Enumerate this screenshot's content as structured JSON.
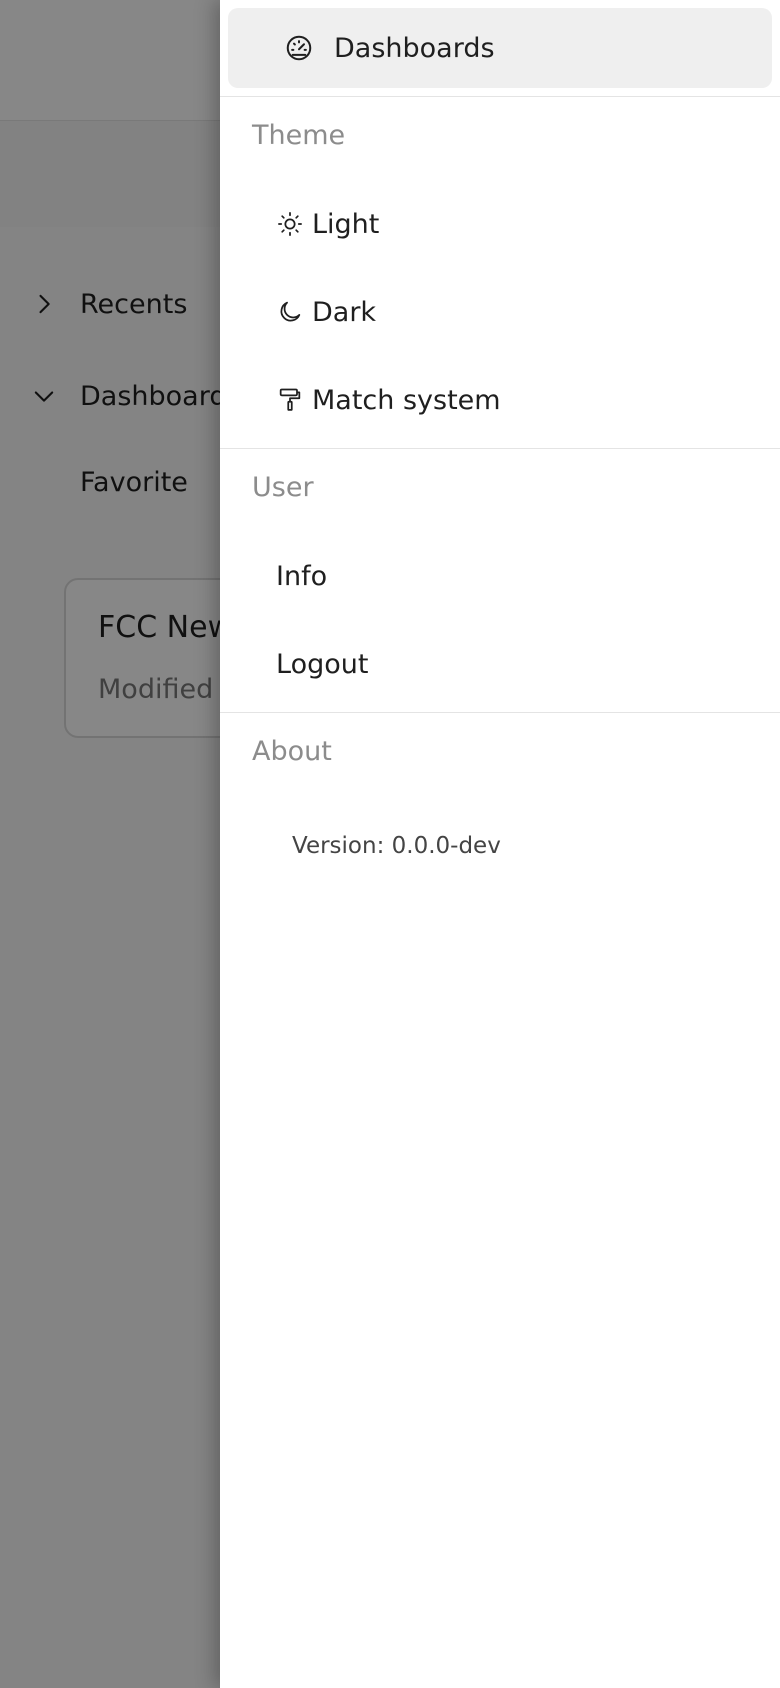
{
  "background": {
    "sidebar": {
      "items": [
        {
          "label": "Recents",
          "icon": "chevron-right-icon"
        },
        {
          "label": "Dashboards",
          "icon": "chevron-down-icon"
        },
        {
          "label": "Favorite"
        }
      ]
    },
    "card": {
      "title": "FCC New",
      "subtitle": "Modified"
    }
  },
  "drawer": {
    "nav": {
      "label": "Dashboards",
      "icon": "dashboard-gauge-icon"
    },
    "theme": {
      "title": "Theme",
      "options": [
        {
          "label": "Light",
          "icon": "sun-icon"
        },
        {
          "label": "Dark",
          "icon": "moon-icon"
        },
        {
          "label": "Match system",
          "icon": "paint-roller-icon"
        }
      ]
    },
    "user": {
      "title": "User",
      "items": [
        {
          "label": "Info"
        },
        {
          "label": "Logout"
        }
      ]
    },
    "about": {
      "title": "About",
      "version": "Version: 0.0.0-dev"
    }
  },
  "colors": {
    "overlay": "#000000",
    "nav_active_bg": "#efefef",
    "section_title": "#8c8c8c"
  }
}
